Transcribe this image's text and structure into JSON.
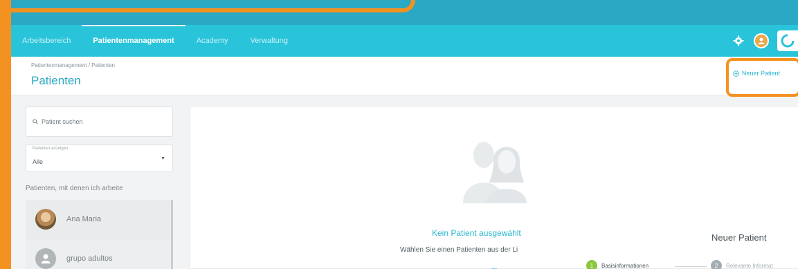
{
  "colors": {
    "accent": "#29c4da",
    "highlight": "#f39221",
    "step_active": "#8cc63f",
    "step_inactive": "#a5adb1"
  },
  "navbar": {
    "items": [
      {
        "label": "Arbeitsbereich",
        "active": false
      },
      {
        "label": "Patientenmanagement",
        "active": true
      },
      {
        "label": "Academy",
        "active": false
      },
      {
        "label": "Verwaltung",
        "active": false
      }
    ],
    "icons": [
      "gear-icon",
      "user-avatar",
      "app-logo"
    ]
  },
  "header": {
    "breadcrumb": "Patientenmanagement / Patienten",
    "title": "Patienten",
    "new_patient_label": "Neuer Patient",
    "new_patient_icon": "plus-circle-icon"
  },
  "sidebar": {
    "search_placeholder": "Patient suchen",
    "filter_label": "Patienten anzeigen",
    "filter_value": "Alle",
    "section_label": "Patienten, mit denen ich arbeite",
    "patients": [
      {
        "name": "Ana Maria",
        "avatar": "photo"
      },
      {
        "name": "grupo adultos",
        "avatar": "generic-user-icon"
      }
    ]
  },
  "main": {
    "empty_title": "Kein Patient ausgewählt",
    "empty_subtitle": "Wählen Sie einen Patienten aus der Li",
    "back_icon": "arrow-left-icon",
    "new_panel": {
      "title": "Neuer Patient",
      "steps": [
        {
          "number": "1",
          "label": "Basisinformationen",
          "active": true
        },
        {
          "number": "2",
          "label": "Relevante Informat",
          "active": false
        }
      ]
    }
  }
}
